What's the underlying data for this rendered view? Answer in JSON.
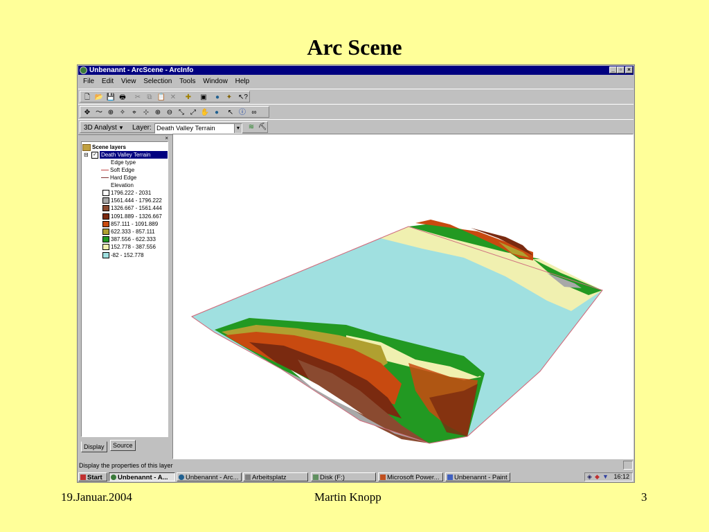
{
  "slide": {
    "title": "Arc Scene",
    "footer_date": "19.Januar.2004",
    "footer_author": "Martin Knopp",
    "footer_page": "3"
  },
  "window": {
    "title": "Unbenannt - ArcScene - ArcInfo",
    "minimize": "_",
    "maximize": "▫",
    "close": "×"
  },
  "menu": [
    "File",
    "Edit",
    "View",
    "Selection",
    "Tools",
    "Window",
    "Help"
  ],
  "toolbar3d": {
    "analyst_label": "3D Analyst",
    "layer_label": "Layer:",
    "layer_value": "Death Valley Terrain"
  },
  "toc": {
    "root": "Scene layers",
    "layer": "Death Valley Terrain",
    "edge_heading": "Edge type",
    "edges": [
      {
        "label": "Soft Edge",
        "color": "#c04040"
      },
      {
        "label": "Hard Edge",
        "color": "#803030"
      }
    ],
    "elevation_heading": "Elevation",
    "classes": [
      {
        "label": "1796.222 - 2031",
        "color": "#ffffff"
      },
      {
        "label": "1561.444 - 1796.222",
        "color": "#a8a8a8"
      },
      {
        "label": "1326.667 - 1561.444",
        "color": "#8a4a30"
      },
      {
        "label": "1091.889 - 1326.667",
        "color": "#7a2a10"
      },
      {
        "label": "857.111 - 1091.889",
        "color": "#c84a10"
      },
      {
        "label": "622.333 - 857.111",
        "color": "#b0a030"
      },
      {
        "label": "387.556 - 622.333",
        "color": "#229922"
      },
      {
        "label": "152.778 - 387.556",
        "color": "#f0f0b0"
      },
      {
        "label": "-82 - 152.778",
        "color": "#a0e0e0"
      }
    ],
    "tab_display": "Display",
    "tab_source": "Source"
  },
  "status": {
    "text": "Display the properties of this layer"
  },
  "taskbar": {
    "start": "Start",
    "tasks": [
      "Unbenannt - A...",
      "Unbenannt - Arc...",
      "Arbeitsplatz",
      "Disk (F:)",
      "Microsoft Power...",
      "Unbenannt - Paint"
    ],
    "clock": "16:12"
  }
}
